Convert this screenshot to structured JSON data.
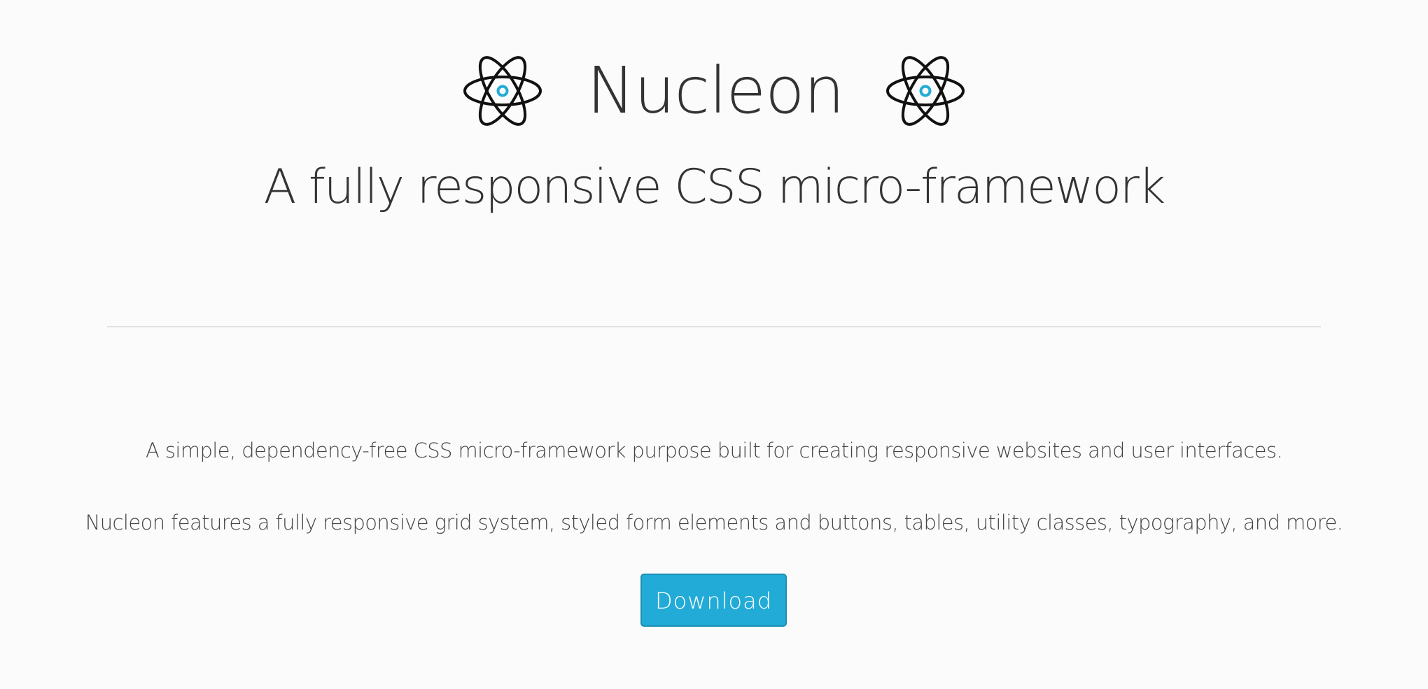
{
  "header": {
    "title": "Nucleon",
    "subtitle": "A fully responsive CSS micro-framework",
    "left_icon": "atom-icon",
    "right_icon": "atom-icon"
  },
  "main": {
    "intro_line_1": "A simple, dependency-free CSS micro-framework purpose built for creating responsive websites and user interfaces.",
    "intro_line_2": "Nucleon features a fully responsive grid system, styled form elements and buttons, tables, utility classes, typography, and more.",
    "download_label": "Download"
  },
  "colors": {
    "accent": "#22abd6",
    "text": "#333333",
    "background": "#fbfbfb",
    "divider": "#e1e1e1"
  }
}
